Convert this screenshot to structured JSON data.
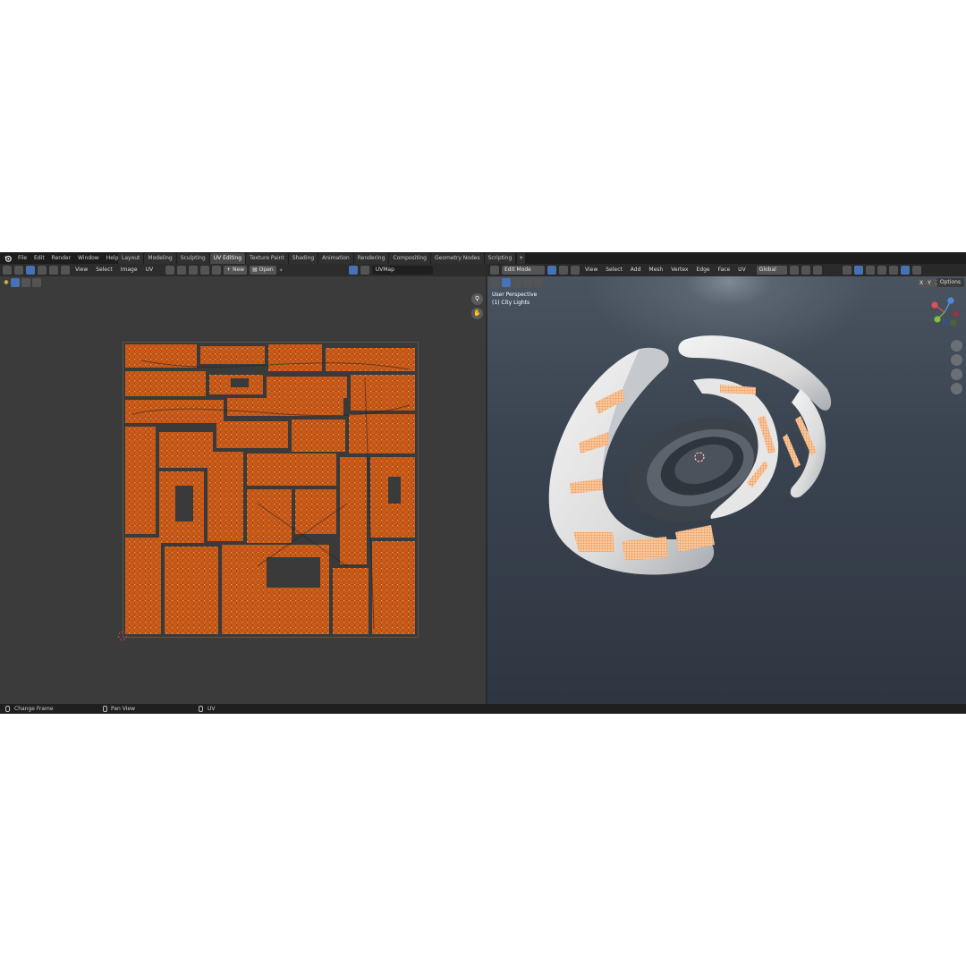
{
  "menubar": {
    "items": [
      "File",
      "Edit",
      "Render",
      "Window",
      "Help"
    ]
  },
  "workspace_tabs": [
    "Layout",
    "Modeling",
    "Sculpting",
    "UV Editing",
    "Texture Paint",
    "Shading",
    "Animation",
    "Rendering",
    "Compositing",
    "Geometry Nodes",
    "Scripting"
  ],
  "active_tab": "UV Editing",
  "uv_editor": {
    "menus": [
      "View",
      "Select",
      "Image",
      "UV"
    ],
    "new_label": "New",
    "open_label": "Open",
    "uvmap_field": "UVMap"
  },
  "viewport": {
    "mode": "Edit Mode",
    "menus": [
      "View",
      "Select",
      "Add",
      "Mesh",
      "Vertex",
      "Edge",
      "Face",
      "UV"
    ],
    "transform_orientation": "Global",
    "overlay_line1": "User Perspective",
    "overlay_line2": "(1) City Lights",
    "axis_buttons": [
      "X",
      "Y",
      "Z"
    ],
    "options_label": "Options"
  },
  "statusbar": {
    "change_frame": "Change Frame",
    "pan_view": "Pan View",
    "uv": "UV"
  },
  "colors": {
    "uv_island": "#e2661a",
    "uv_vertex": "#ff9a3c",
    "mesh_body": "#ececec",
    "mesh_dark": "#3e444c",
    "accent_blue": "#4772b3"
  }
}
